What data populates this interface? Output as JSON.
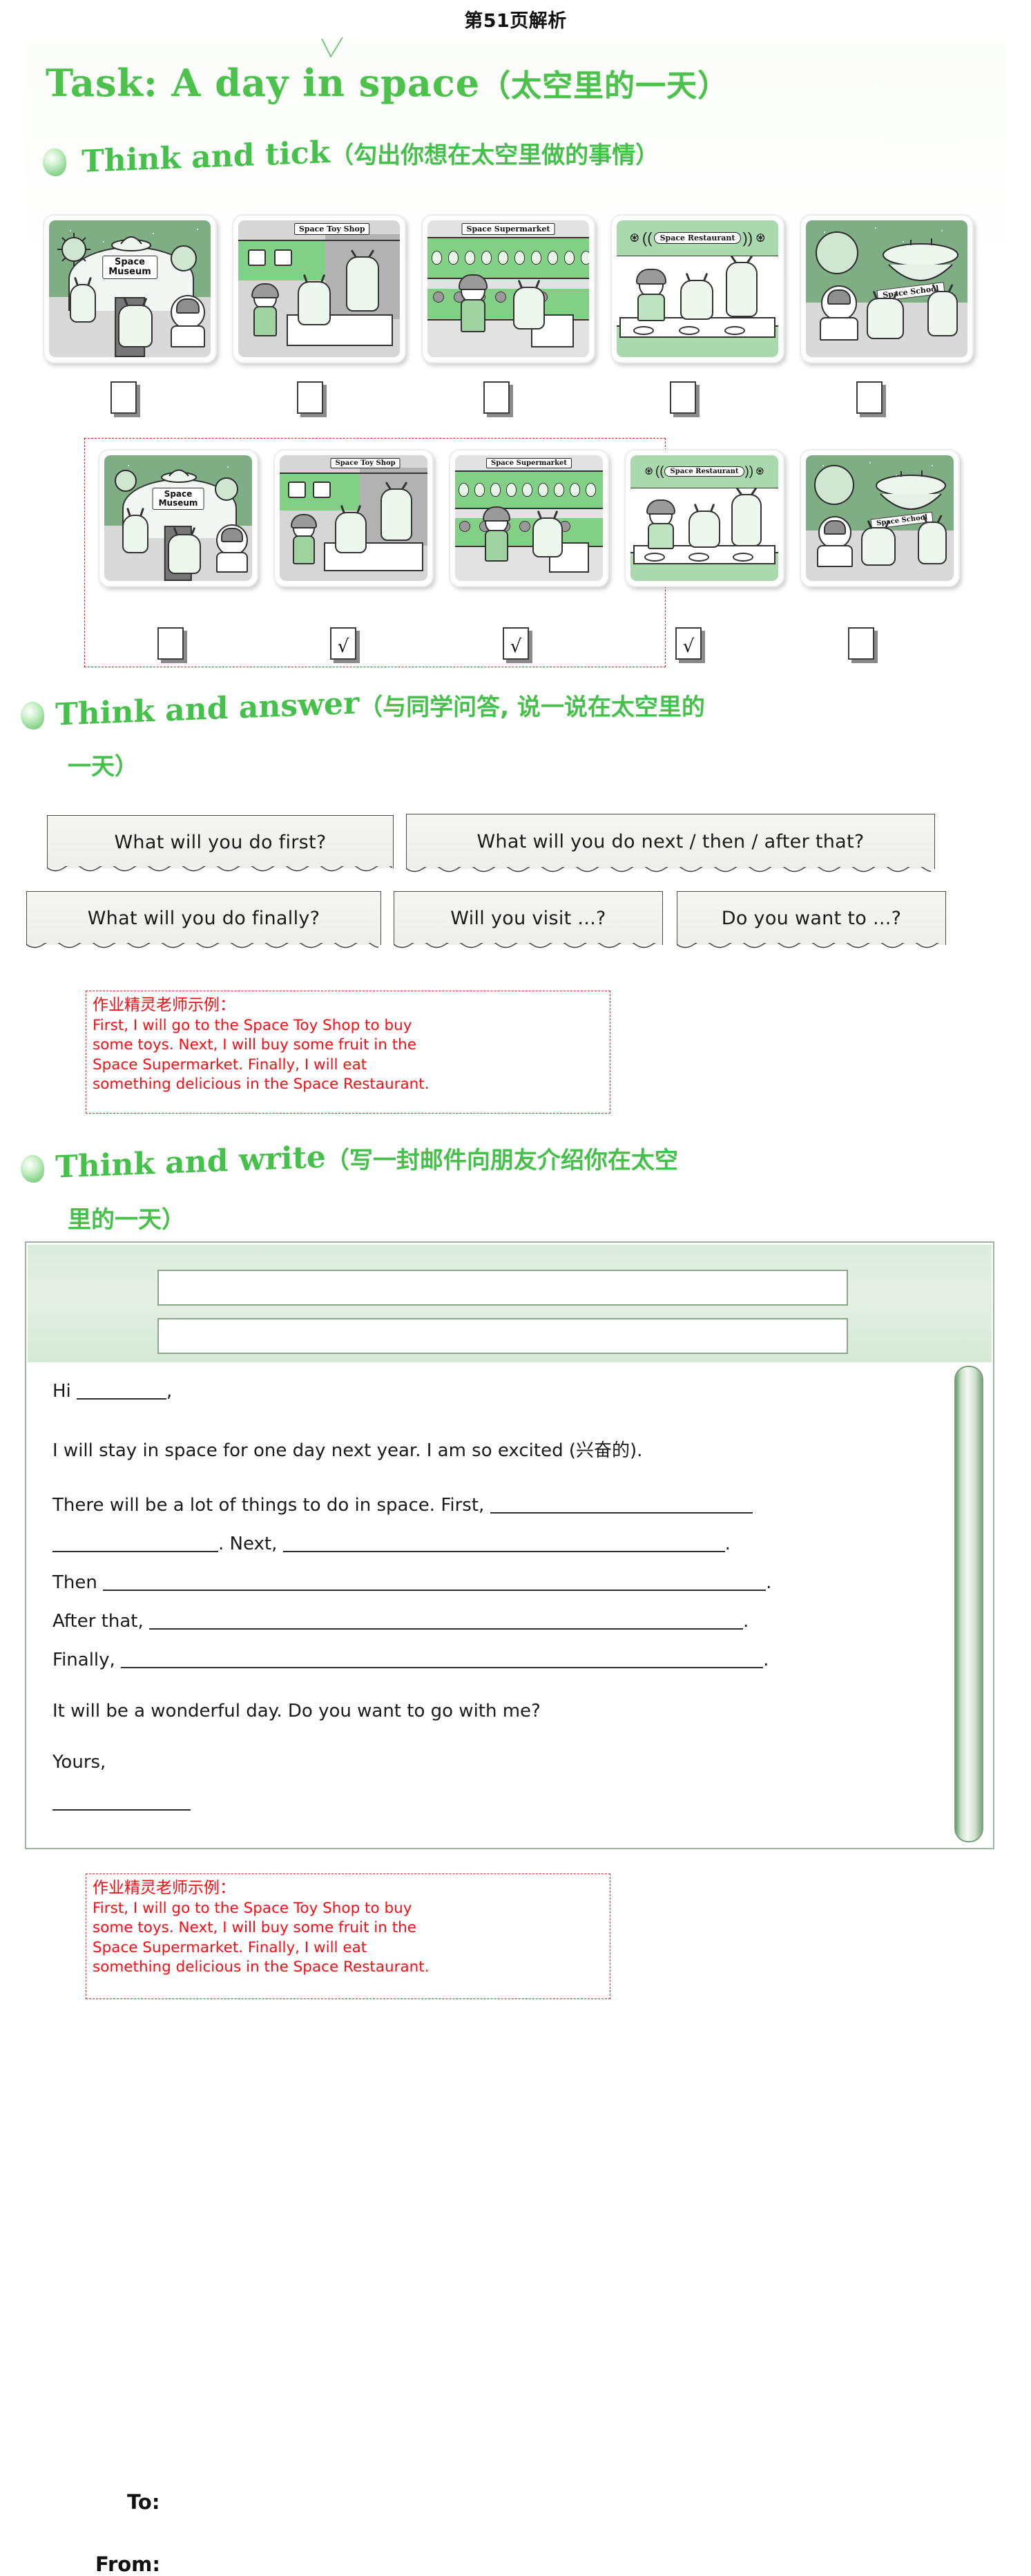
{
  "page": {
    "header": "第51页解析"
  },
  "task": {
    "title_en": "Task: A day in space",
    "title_cn": "（太空里的一天）"
  },
  "sections": [
    {
      "id": "think-and-tick",
      "en": "Think and tick",
      "cn": "（勾出你想在太空里做的事情）"
    },
    {
      "id": "think-and-answer",
      "en": "Think and answer",
      "cn": "（与同学问答, 说一说在太空里的",
      "cn_line2": "一天）"
    },
    {
      "id": "think-and-write",
      "en": "Think and write",
      "cn": "（写一封邮件向朋友介绍你在太空",
      "cn_line2": "里的一天）"
    }
  ],
  "pictures": [
    {
      "name": "space-museum",
      "label": "Space\nMuseum",
      "label_line1": "Space",
      "label_line2": "Museum",
      "ticked": false
    },
    {
      "name": "space-toy-shop",
      "label": "Space Toy Shop",
      "ticked": true
    },
    {
      "name": "space-supermarket",
      "label": "Space Supermarket",
      "ticked": true
    },
    {
      "name": "space-restaurant",
      "label": "Space Restaurant",
      "ticked": true
    },
    {
      "name": "space-school",
      "label": "Space School",
      "ticked": false
    }
  ],
  "tick_marks": {
    "row1": [
      "",
      "",
      "",
      "",
      ""
    ],
    "row2": [
      "",
      "√",
      "√",
      "√",
      ""
    ]
  },
  "questions": [
    "What will you do first?",
    "What will you do next / then / after that?",
    "What will you do finally?",
    "Will you visit ...?",
    "Do you want to ...?"
  ],
  "teacher_example": {
    "heading": "作业精灵老师示例：",
    "line1": "First, I will go to the Space Toy Shop to buy",
    "line2": "some toys. Next, I will buy some fruit in the",
    "line3": "Space Supermarket. Finally, I will eat",
    "line4": "something delicious in the Space Restaurant."
  },
  "email": {
    "to_label": "To:",
    "from_label": "From:",
    "to_value": "",
    "from_value": "",
    "greeting": "Hi",
    "greeting_comma": ",",
    "body": [
      "I will stay in space for one day next year. I am so excited (兴奋的).",
      "There will be a lot of things to do in space. First,",
      ". Next,",
      "Then",
      "After that,",
      "Finally,",
      "It will be a wonderful day. Do you want to go with me?",
      "Yours,"
    ],
    "line_first": "There will be a lot of things to do in space. First,",
    "line_next_prefix": ". Next,",
    "line_then": "Then",
    "line_after": "After that,",
    "line_finally": "Finally,",
    "line_wonderful": "It will be a wonderful day. Do you want to go with me?",
    "line_yours": "Yours,",
    "period": "."
  },
  "colors": {
    "green_heading": "#45c04a",
    "red_annotation": "#fb0b12",
    "red_border": "#e8202a",
    "mail_green": "#dcecdc"
  }
}
